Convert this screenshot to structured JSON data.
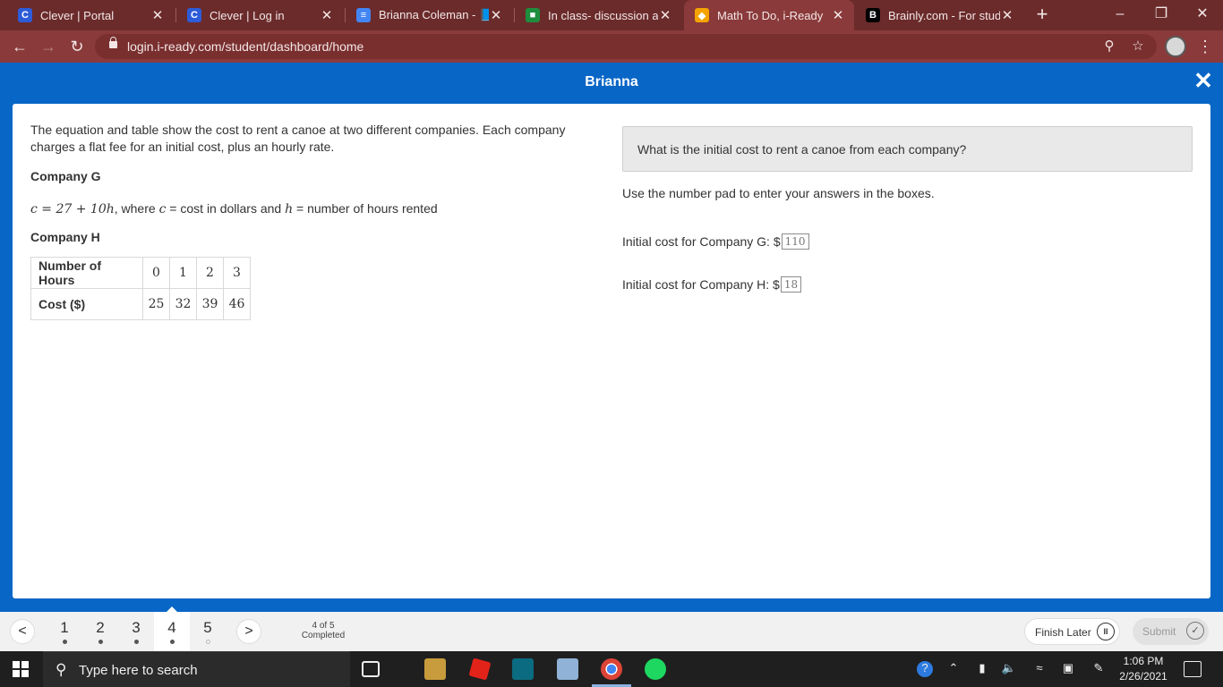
{
  "browser": {
    "tabs": [
      {
        "title": "Clever | Portal",
        "icon": "C",
        "color": "#2d5cd8"
      },
      {
        "title": "Clever | Log in",
        "icon": "C",
        "color": "#2d5cd8"
      },
      {
        "title": "Brianna Coleman - 📘T",
        "icon": "doc",
        "color": "#4285f4"
      },
      {
        "title": "In class- discussion and",
        "icon": "classroom",
        "color": "#1e8e3e"
      },
      {
        "title": "Math To Do, i-Ready",
        "icon": "iready",
        "color": "#f4a300"
      },
      {
        "title": "Brainly.com - For stude",
        "icon": "B",
        "color": "#000000"
      }
    ],
    "active_tab": 4,
    "url": "login.i-ready.com/student/dashboard/home",
    "new_tab_label": "+",
    "min_label": "–",
    "max_label": "❐",
    "close_label": "✕"
  },
  "header": {
    "student_name": "Brianna",
    "close_label": "✕"
  },
  "problem": {
    "intro": "The equation and table show the cost to rent a canoe at two different companies. Each company charges a flat fee for an initial cost, plus an hourly rate.",
    "company_g_label": "Company G",
    "equation_math": "c = 27 + 10h",
    "equation_text_1": ", where ",
    "var_c": "c",
    "equals_1": " = ",
    "equation_text_2": "cost in dollars and ",
    "var_h": "h",
    "equals_2": " = ",
    "equation_text_3": "number of hours rented",
    "company_h_label": "Company H",
    "table": {
      "row1_header": "Number of Hours",
      "row1": [
        "0",
        "1",
        "2",
        "3"
      ],
      "row2_header": "Cost ($)",
      "row2": [
        "25",
        "32",
        "39",
        "46"
      ]
    }
  },
  "question": {
    "prompt": "What is the initial cost to rent a canoe from each company?",
    "instructions": "Use the number pad to enter your answers in the boxes.",
    "answer_g_label": "Initial cost for Company G: $",
    "answer_g_value": "110",
    "answer_h_label": "Initial cost for Company H: $",
    "answer_h_value": "18"
  },
  "bottom_nav": {
    "prev_label": "<",
    "next_label": ">",
    "questions": [
      "1",
      "2",
      "3",
      "4",
      "5"
    ],
    "completed": [
      true,
      true,
      true,
      true,
      false
    ],
    "current": 4,
    "progress_line1": "4 of 5",
    "progress_line2": "Completed",
    "finish_later": "Finish Later",
    "pause_label": "II",
    "submit": "Submit",
    "check_label": "✓"
  },
  "taskbar": {
    "search_placeholder": "Type here to search",
    "time": "1:06 PM",
    "date": "2/26/2021"
  }
}
